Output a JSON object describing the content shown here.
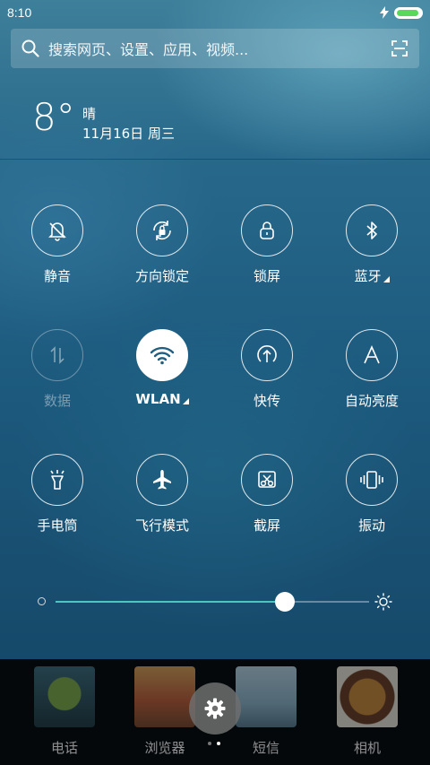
{
  "status_bar": {
    "time": "8:10",
    "battery_color": "#5ad85a",
    "battery_level": 0.92
  },
  "search": {
    "placeholder": "搜索网页、设置、应用、视频...",
    "icons": [
      "search-icon",
      "scan-icon"
    ]
  },
  "weather": {
    "temperature": "8°",
    "condition": "晴",
    "date": "11月16日 周三"
  },
  "toggles": [
    {
      "label": "静音",
      "icon": "silent-bell-icon",
      "state": "off"
    },
    {
      "label": "方向锁定",
      "icon": "rotation-lock-icon",
      "state": "off"
    },
    {
      "label": "锁屏",
      "icon": "lock-icon",
      "state": "off"
    },
    {
      "label": "蓝牙",
      "icon": "bluetooth-icon",
      "state": "off",
      "has_submenu": true
    },
    {
      "label": "数据",
      "icon": "mobile-data-icon",
      "state": "disabled"
    },
    {
      "label": "WLAN",
      "icon": "wifi-icon",
      "state": "on",
      "has_submenu": true
    },
    {
      "label": "快传",
      "icon": "quick-transfer-icon",
      "state": "off"
    },
    {
      "label": "自动亮度",
      "icon": "auto-brightness-icon",
      "state": "off"
    },
    {
      "label": "手电筒",
      "icon": "flashlight-icon",
      "state": "off"
    },
    {
      "label": "飞行模式",
      "icon": "airplane-icon",
      "state": "off"
    },
    {
      "label": "截屏",
      "icon": "screenshot-icon",
      "state": "off"
    },
    {
      "label": "振动",
      "icon": "vibrate-icon",
      "state": "off"
    }
  ],
  "brightness": {
    "level": 0.73,
    "accent_color": "#4cc7c0"
  },
  "dock": {
    "apps": [
      {
        "label": "电话",
        "thumb": "plant-wallpaper"
      },
      {
        "label": "浏览器",
        "thumb": "ship-wallpaper"
      },
      {
        "label": "短信",
        "thumb": "couple-wallpaper"
      },
      {
        "label": "相机",
        "thumb": "plate-wallpaper"
      }
    ],
    "settings_icon": "gear-icon",
    "page_count": 2,
    "active_page": 2
  }
}
